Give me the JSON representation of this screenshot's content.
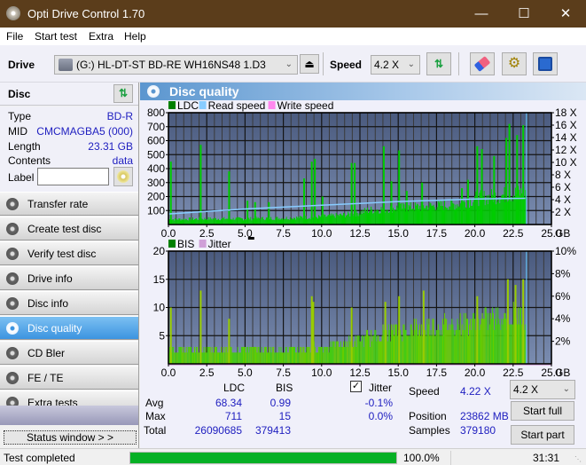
{
  "window": {
    "title": "Opti Drive Control 1.70",
    "minimize": "—",
    "maximize": "☐",
    "close": "✕"
  },
  "menu": [
    "File",
    "Start test",
    "Extra",
    "Help"
  ],
  "toolbar": {
    "drive_label": "Drive",
    "drive_value": "(G:)  HL-DT-ST BD-RE  WH16NS48 1.D3",
    "speed_label": "Speed",
    "speed_value": "4.2 X",
    "icons": [
      "eject-icon",
      "refresh-icon",
      "erase-icon",
      "settings-icon",
      "save-icon"
    ]
  },
  "disc": {
    "header": "Disc",
    "rows": [
      {
        "key": "Type",
        "value": "BD-R"
      },
      {
        "key": "MID",
        "value": "CMCMAGBA5 (000)"
      },
      {
        "key": "Length",
        "value": "23.31 GB"
      },
      {
        "key": "Contents",
        "value": "data"
      }
    ],
    "label_key": "Label",
    "label_value": ""
  },
  "nav": [
    {
      "label": "Transfer rate",
      "active": false
    },
    {
      "label": "Create test disc",
      "active": false
    },
    {
      "label": "Verify test disc",
      "active": false
    },
    {
      "label": "Drive info",
      "active": false
    },
    {
      "label": "Disc info",
      "active": false
    },
    {
      "label": "Disc quality",
      "active": true
    },
    {
      "label": "CD Bler",
      "active": false
    },
    {
      "label": "FE / TE",
      "active": false
    },
    {
      "label": "Extra tests",
      "active": false
    }
  ],
  "status_window_button": "Status window > >",
  "panel": {
    "title": "Disc quality"
  },
  "chart_data": [
    {
      "type": "bar",
      "title": "LDC / Read speed",
      "legend": [
        {
          "name": "LDC",
          "color": "#008000"
        },
        {
          "name": "Read speed",
          "color": "#88ccff"
        },
        {
          "name": "Write speed",
          "color": "#ff88ee"
        }
      ],
      "legend_placement": "top-left",
      "x_ticks": [
        "0.0",
        "2.5",
        "5.0",
        "7.5",
        "10.0",
        "12.5",
        "15.0",
        "17.5",
        "20.0",
        "22.5",
        "25.0"
      ],
      "x_unit": "GB",
      "xlim": [
        0,
        25
      ],
      "y_ticks": [
        "100",
        "200",
        "300",
        "400",
        "500",
        "600",
        "700",
        "800"
      ],
      "ylim": [
        0,
        800
      ],
      "y2_ticks": [
        "2 X",
        "4 X",
        "6 X",
        "8 X",
        "10 X",
        "12 X",
        "14 X",
        "16 X",
        "18 X"
      ],
      "y2lim": [
        0,
        18
      ],
      "data_end_gb": 23.31,
      "ldc_baseline": [
        [
          0,
          40
        ],
        [
          2.5,
          45
        ],
        [
          5,
          45
        ],
        [
          7.5,
          50
        ],
        [
          10,
          60
        ],
        [
          12,
          80
        ],
        [
          13,
          110
        ],
        [
          15,
          130
        ],
        [
          17.5,
          145
        ],
        [
          19,
          160
        ],
        [
          20,
          200
        ],
        [
          22,
          230
        ],
        [
          23.3,
          250
        ]
      ],
      "ldc_spikes": [
        [
          0.1,
          450
        ],
        [
          2.05,
          570
        ],
        [
          3.9,
          380
        ],
        [
          5.1,
          170
        ],
        [
          5.6,
          160
        ],
        [
          6.5,
          160
        ],
        [
          8.8,
          330
        ],
        [
          9.3,
          450
        ],
        [
          9.5,
          470
        ],
        [
          10,
          200
        ],
        [
          11.9,
          440
        ],
        [
          12.1,
          440
        ],
        [
          14,
          560
        ],
        [
          14.5,
          310
        ],
        [
          15,
          530
        ],
        [
          15.5,
          240
        ],
        [
          16.5,
          300
        ],
        [
          19.1,
          260
        ],
        [
          19.5,
          320
        ],
        [
          20.1,
          560
        ],
        [
          20.4,
          540
        ],
        [
          21.2,
          490
        ],
        [
          22,
          620
        ],
        [
          22.2,
          720
        ],
        [
          22.7,
          640
        ],
        [
          23.1,
          711
        ]
      ],
      "read_speed": [
        [
          0,
          1.7
        ],
        [
          2.5,
          2.1
        ],
        [
          5,
          2.5
        ],
        [
          7.5,
          2.8
        ],
        [
          10,
          3.1
        ],
        [
          12.5,
          3.4
        ],
        [
          15,
          3.7
        ],
        [
          17.5,
          3.9
        ],
        [
          20,
          4.1
        ],
        [
          22.5,
          4.2
        ],
        [
          23.3,
          4.22
        ]
      ]
    },
    {
      "type": "bar",
      "title": "BIS / Jitter",
      "legend": [
        {
          "name": "BIS",
          "color": "#008000"
        },
        {
          "name": "Jitter",
          "color": "#d0a0d8"
        }
      ],
      "legend_placement": "top-left",
      "x_ticks": [
        "0.0",
        "2.5",
        "5.0",
        "7.5",
        "10.0",
        "12.5",
        "15.0",
        "17.5",
        "20.0",
        "22.5",
        "25.0"
      ],
      "x_unit": "GB",
      "xlim": [
        0,
        25
      ],
      "y_ticks": [
        "5",
        "10",
        "15",
        "20"
      ],
      "ylim": [
        0,
        20
      ],
      "y2_ticks": [
        "2%",
        "4%",
        "6%",
        "8%",
        "10%"
      ],
      "y2lim": [
        0,
        10
      ],
      "data_end_gb": 23.31,
      "bis_baseline": [
        [
          0,
          3
        ],
        [
          2.5,
          3
        ],
        [
          5,
          3
        ],
        [
          7.5,
          3
        ],
        [
          10,
          3.5
        ],
        [
          11,
          4
        ],
        [
          12.5,
          5
        ],
        [
          13.5,
          6
        ],
        [
          15,
          7
        ],
        [
          17.5,
          8
        ],
        [
          20,
          9
        ],
        [
          22.5,
          10
        ],
        [
          23.3,
          10
        ]
      ],
      "bis_spikes": [
        [
          0.1,
          10
        ],
        [
          2.05,
          13
        ],
        [
          3.9,
          8
        ],
        [
          9.3,
          12
        ],
        [
          9.4,
          11
        ],
        [
          11.9,
          10
        ],
        [
          14.1,
          11
        ],
        [
          15,
          12
        ],
        [
          16.6,
          13
        ],
        [
          20.1,
          12
        ],
        [
          22.1,
          15
        ],
        [
          22.6,
          14
        ],
        [
          23.1,
          15
        ]
      ]
    }
  ],
  "stats": {
    "col_ldc": "LDC",
    "col_bis": "BIS",
    "jitter_label": "Jitter",
    "jitter_checked": true,
    "rows": [
      {
        "label": "Avg",
        "ldc": "68.34",
        "bis": "0.99",
        "jitter": "-0.1%"
      },
      {
        "label": "Max",
        "ldc": "711",
        "bis": "15",
        "jitter": "0.0%"
      },
      {
        "label": "Total",
        "ldc": "26090685",
        "bis": "379413",
        "jitter": ""
      }
    ],
    "speed_label": "Speed",
    "speed_value": "4.22 X",
    "position_label": "Position",
    "position_value": "23862 MB",
    "samples_label": "Samples",
    "samples_value": "379180",
    "speed_select": "4.2 X",
    "start_full": "Start full",
    "start_part": "Start part"
  },
  "statusbar": {
    "text": "Test completed",
    "progress_percent": 100.0,
    "progress_label": "100.0%",
    "time": "31:31"
  },
  "colors": {
    "title_bar": "#5b3d1b",
    "accent_blue": "#3c94e0",
    "value_blue": "#2020c0",
    "ldc_green": "#00cc00",
    "bis_green": "#44cc00",
    "read_speed": "#88ccff",
    "progress_green": "#06b025"
  }
}
